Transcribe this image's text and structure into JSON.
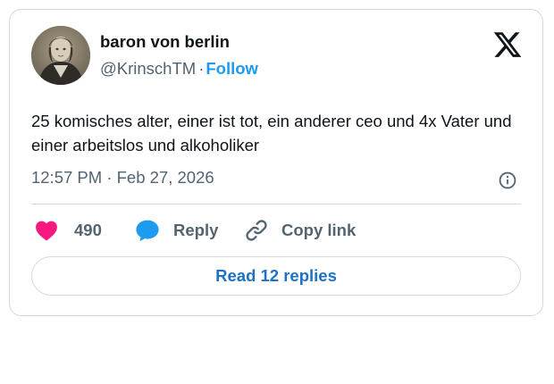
{
  "author": {
    "name": "baron von berlin",
    "handle": "@KrinschTM",
    "separator": "·",
    "follow_label": "Follow",
    "avatar_icon": "profile-photo"
  },
  "brand": {
    "logo_icon": "x-logo-icon"
  },
  "tweet": {
    "text": "25 komisches alter, einer ist tot, ein anderer ceo und 4x Vater und einer arbeitslos und alkoholiker",
    "timestamp": "12:57 PM · Feb 27, 2026",
    "info_icon": "info-icon"
  },
  "actions": {
    "like": {
      "icon": "heart-icon",
      "count": "490",
      "color": "#f91880"
    },
    "reply": {
      "icon": "speech-bubble-icon",
      "label": "Reply",
      "color": "#1d9bf0"
    },
    "copy_link": {
      "icon": "link-icon",
      "label": "Copy link"
    }
  },
  "read_replies": {
    "label": "Read 12 replies"
  },
  "colors": {
    "accent": "#1d9bf0",
    "text_primary": "#0f1419",
    "text_secondary": "#536471",
    "border": "#cfd9de",
    "replies_link": "#1d72c8"
  }
}
